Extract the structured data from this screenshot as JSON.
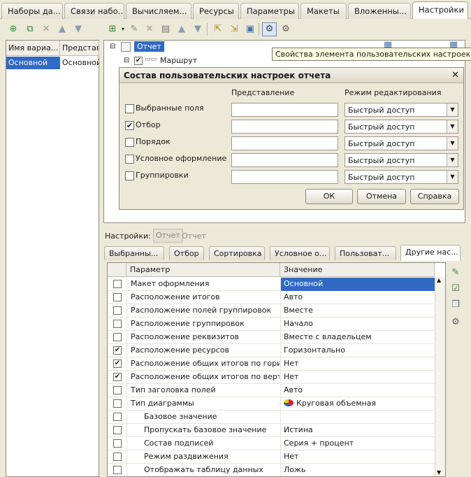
{
  "tabs": [
    {
      "label": "Наборы да..."
    },
    {
      "label": "Связи набо..."
    },
    {
      "label": "Вычисляем..."
    },
    {
      "label": "Ресурсы"
    },
    {
      "label": "Параметры"
    },
    {
      "label": "Макеты"
    },
    {
      "label": "Вложенны..."
    },
    {
      "label": "Настройки"
    }
  ],
  "variants": {
    "headers": [
      "Имя вариа...",
      "Представл"
    ],
    "rows": [
      {
        "name": "Основной",
        "presentation": "Основной"
      }
    ]
  },
  "tree": {
    "root": "Отчет",
    "child": "Маршрут",
    "tooltip": "Свойства элемента пользовательских настроек"
  },
  "dialog": {
    "title": "Состав пользовательских настроек отчета",
    "close": "✕",
    "col_presentation": "Представление",
    "col_mode": "Режим редактирования",
    "items": [
      {
        "label": "Выбранные поля",
        "checked": false,
        "mode": "Быстрый доступ"
      },
      {
        "label": "Отбор",
        "checked": true,
        "mode": "Быстрый доступ"
      },
      {
        "label": "Порядок",
        "checked": false,
        "mode": "Быстрый доступ"
      },
      {
        "label": "Условное оформление",
        "checked": false,
        "mode": "Быстрый доступ"
      },
      {
        "label": "Группировки",
        "checked": false,
        "mode": "Быстрый доступ"
      }
    ],
    "ok": "ОК",
    "cancel": "Отмена",
    "help": "Справка"
  },
  "settings": {
    "label": "Настройки:",
    "btn1": "Отчет",
    "btn2": "Отчет"
  },
  "settings_tabs": [
    {
      "label": "Выбранны..."
    },
    {
      "label": "Отбор"
    },
    {
      "label": "Сортировка"
    },
    {
      "label": "Условное о..."
    },
    {
      "label": "Пользоват..."
    },
    {
      "label": "Другие нас..."
    }
  ],
  "grid": {
    "col_param": "Параметр",
    "col_value": "Значение",
    "rows": [
      {
        "name": "Макет оформления",
        "value": "Основной",
        "checked": false,
        "indent": false,
        "selected": true
      },
      {
        "name": "Расположение итогов",
        "value": "Авто",
        "checked": false,
        "indent": false
      },
      {
        "name": "Расположение полей группировок",
        "value": "Вместе",
        "checked": false,
        "indent": false
      },
      {
        "name": "Расположение группировок",
        "value": "Начало",
        "checked": false,
        "indent": false
      },
      {
        "name": "Расположение реквизитов",
        "value": "Вместе с владельцем",
        "checked": false,
        "indent": false
      },
      {
        "name": "Расположение ресурсов",
        "value": "Горизонтально",
        "checked": true,
        "indent": false
      },
      {
        "name": "Расположение общих итогов по горизо...",
        "value": "Нет",
        "checked": true,
        "indent": false
      },
      {
        "name": "Расположение общих итогов по вертик...",
        "value": "Нет",
        "checked": true,
        "indent": false
      },
      {
        "name": "Тип заголовка полей",
        "value": "Авто",
        "checked": false,
        "indent": false
      },
      {
        "name": "Тип диаграммы",
        "value": "Круговая объемная",
        "checked": false,
        "indent": false,
        "pie": true
      },
      {
        "name": "Базовое значение",
        "value": "",
        "checked": false,
        "indent": true
      },
      {
        "name": "Пропускать базовое значение",
        "value": "Истина",
        "checked": false,
        "indent": true
      },
      {
        "name": "Состав подписей",
        "value": "Серия + процент",
        "checked": false,
        "indent": true
      },
      {
        "name": "Режим раздвижения",
        "value": "Нет",
        "checked": false,
        "indent": true
      },
      {
        "name": "Отображать таблицу данных",
        "value": "Ложь",
        "checked": false,
        "indent": true
      }
    ]
  }
}
